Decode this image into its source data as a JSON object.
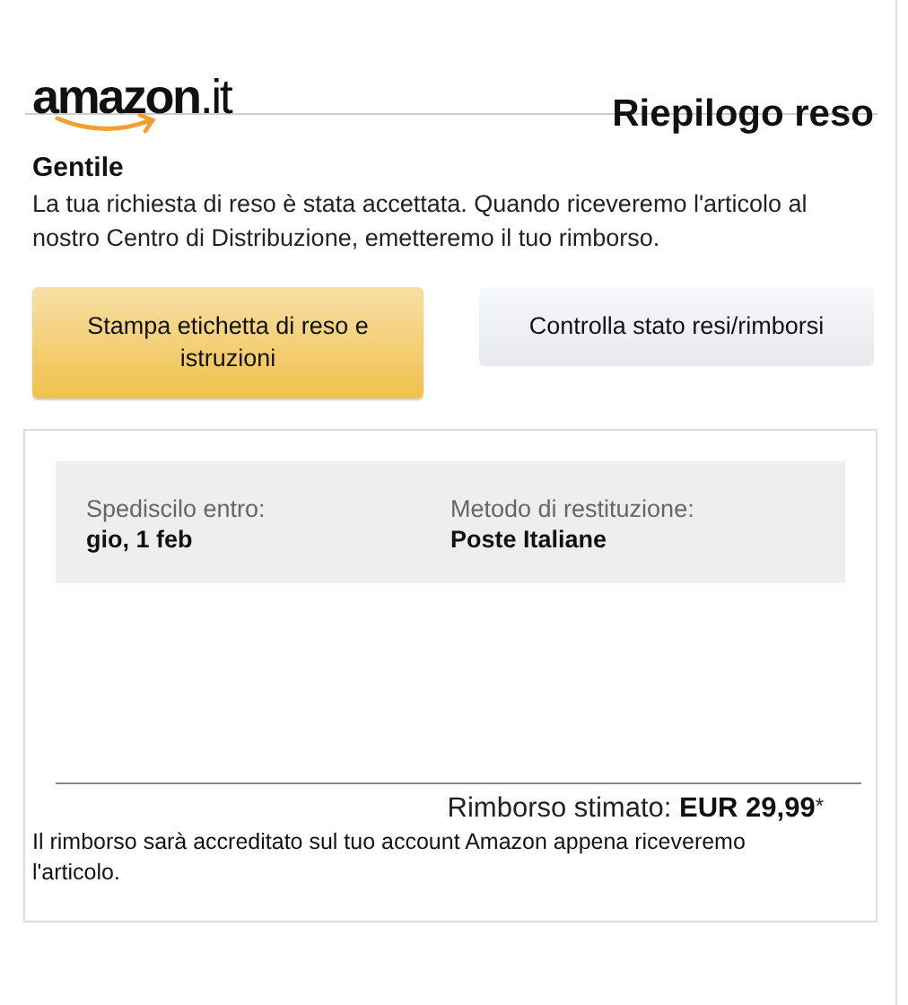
{
  "header": {
    "logo": "**amazon**.it",
    "title": "Riepilogo reso"
  },
  "greeting": "Gentile",
  "message": "La tua richiesta di reso è stata accettata. Quando riceveremo l'articolo al nostro Centro di Distribuzione, emetteremo il tuo rimborso.",
  "buttons": [
    {
      "label": "Stampa etichetta di reso e istruzioni",
      "kind": "primary"
    },
    {
      "label": "Controlla stato resi/rimborsi",
      "kind": "secondary"
    }
  ],
  "details": [
    {
      "label": "Spediscilo entro:",
      "value": "gio, 1 feb"
    },
    {
      "label": "Metodo di restituzione:",
      "value": "Poste Italiane"
    }
  ],
  "refund": {
    "label": "Rimborso stimato:",
    "amount": "EUR 29,99",
    "mark": "*",
    "note": "Il rimborso sarà accreditato sul tuo account Amazon appena riceveremo l'articolo."
  }
}
